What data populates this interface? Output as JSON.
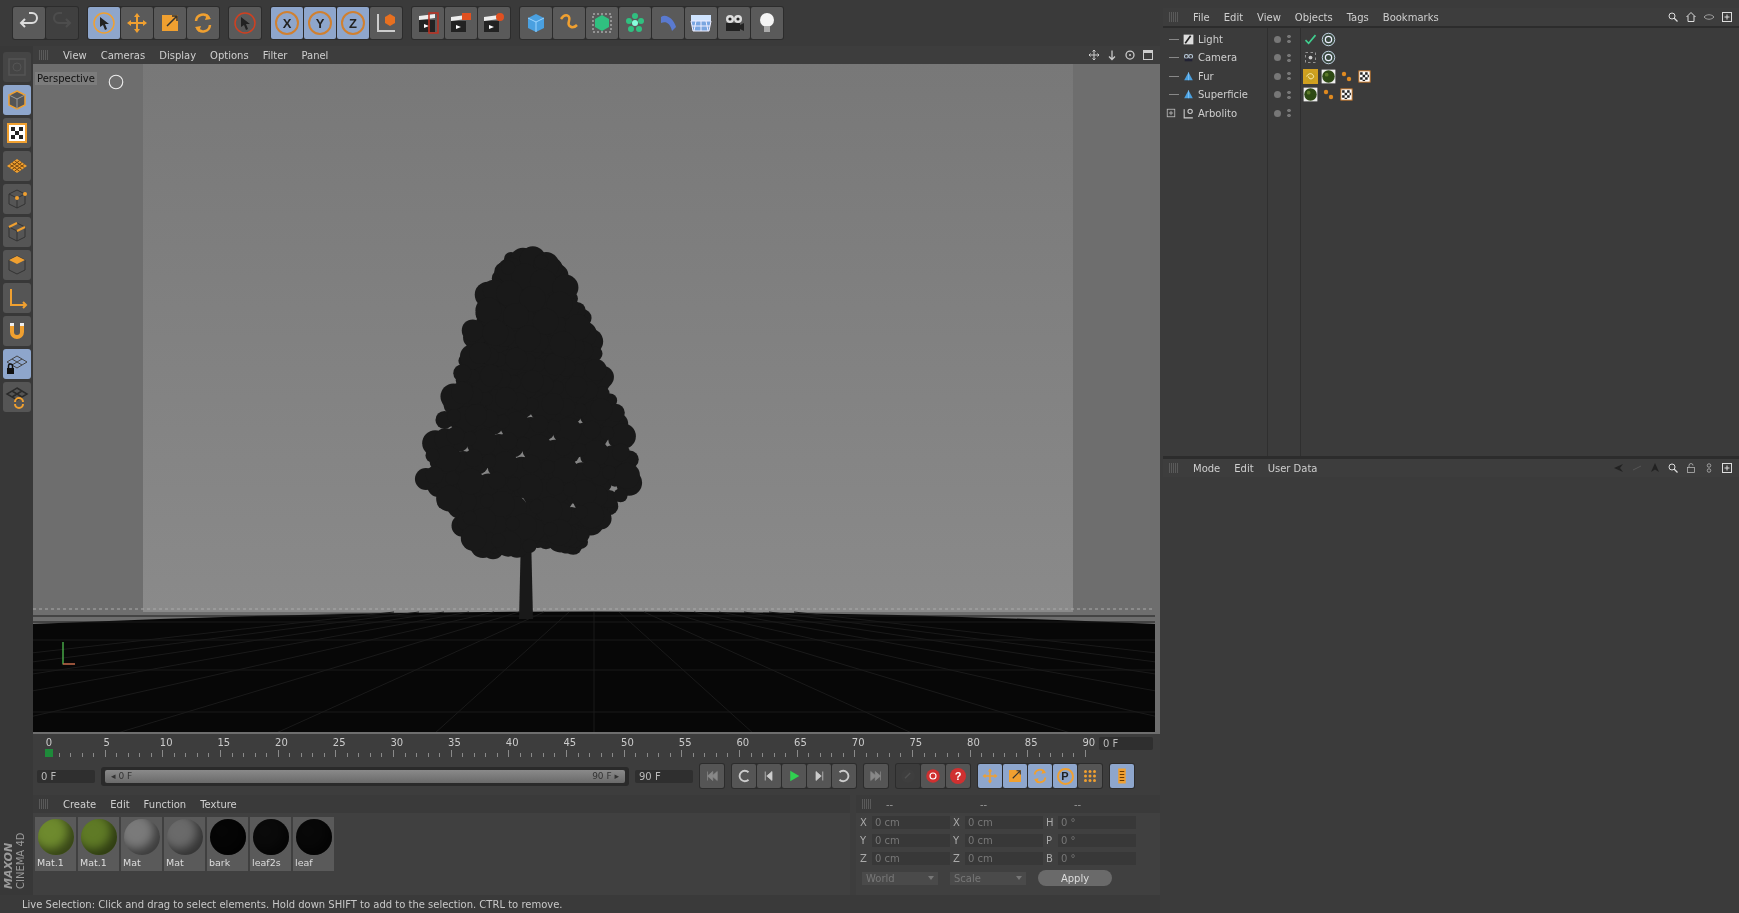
{
  "toolbar": [
    [
      {
        "kind": "undo",
        "selected": false,
        "disabled": false
      },
      {
        "kind": "redo",
        "selected": false,
        "disabled": true
      }
    ],
    [
      {
        "kind": "live-select",
        "selected": true,
        "disabled": false
      },
      {
        "kind": "move",
        "selected": false,
        "disabled": false
      },
      {
        "kind": "scale",
        "selected": false,
        "disabled": false
      },
      {
        "kind": "rotate",
        "selected": false,
        "disabled": false
      }
    ],
    [
      {
        "kind": "recent",
        "selected": false,
        "disabled": false
      }
    ],
    [
      {
        "kind": "axis",
        "label": "X",
        "selected": true,
        "disabled": false
      },
      {
        "kind": "axis",
        "label": "Y",
        "selected": true,
        "disabled": false
      },
      {
        "kind": "axis",
        "label": "Z",
        "selected": true,
        "disabled": false
      },
      {
        "kind": "coord",
        "selected": false,
        "disabled": false
      }
    ],
    [
      {
        "kind": "render-view",
        "selected": false,
        "disabled": false
      },
      {
        "kind": "render-picture",
        "selected": false,
        "disabled": false
      },
      {
        "kind": "render-settings",
        "selected": false,
        "disabled": false
      }
    ],
    [
      {
        "kind": "cube",
        "selected": false,
        "disabled": false
      },
      {
        "kind": "spline",
        "selected": false,
        "disabled": false
      },
      {
        "kind": "subdivision",
        "selected": false,
        "disabled": false
      },
      {
        "kind": "array",
        "selected": false,
        "disabled": false
      },
      {
        "kind": "deformer",
        "selected": false,
        "disabled": false
      },
      {
        "kind": "floor",
        "selected": false,
        "disabled": false
      },
      {
        "kind": "camera",
        "selected": false,
        "disabled": false
      },
      {
        "kind": "light",
        "selected": false,
        "disabled": false
      }
    ]
  ],
  "left_tools": [
    {
      "kind": "scene",
      "selected": false,
      "disabled": true
    },
    {
      "kind": "model",
      "selected": true,
      "disabled": false
    },
    {
      "kind": "texture",
      "selected": false,
      "disabled": false
    },
    {
      "kind": "workplane",
      "selected": false,
      "disabled": false
    },
    {
      "kind": "points",
      "selected": false,
      "disabled": false
    },
    {
      "kind": "edges",
      "selected": false,
      "disabled": false
    },
    {
      "kind": "polygons",
      "selected": false,
      "disabled": false
    },
    {
      "kind": "axes",
      "selected": false,
      "disabled": false
    },
    {
      "kind": "snap",
      "selected": false,
      "disabled": false
    },
    {
      "kind": "plane-lock",
      "selected": true,
      "disabled": false
    },
    {
      "kind": "plane-rotate",
      "selected": false,
      "disabled": false
    }
  ],
  "logo": {
    "brand": "MAXON",
    "product": "CINEMA 4D"
  },
  "viewport": {
    "menu": [
      "View",
      "Cameras",
      "Display",
      "Options",
      "Filter",
      "Panel"
    ],
    "camera": "Perspective"
  },
  "timeline": {
    "ticks": [
      "0",
      "5",
      "10",
      "15",
      "20",
      "25",
      "30",
      "35",
      "40",
      "45",
      "50",
      "55",
      "60",
      "65",
      "70",
      "75",
      "80",
      "85",
      "90"
    ],
    "level": 0,
    "current_frame": "0 F"
  },
  "transport": {
    "start": "0 F",
    "range": {
      "min": "◂ 0 F",
      "max": "90 F ▸",
      "level": 1
    },
    "end": "90 F",
    "buttons": [
      [
        {
          "kind": "first",
          "selected": false,
          "disabled": false
        }
      ],
      [
        {
          "kind": "loop-back",
          "selected": false,
          "disabled": false
        },
        {
          "kind": "prev",
          "selected": false,
          "disabled": false
        },
        {
          "kind": "play",
          "selected": false,
          "disabled": false
        },
        {
          "kind": "next",
          "selected": false,
          "disabled": false
        },
        {
          "kind": "loop",
          "selected": false,
          "disabled": false
        }
      ],
      [
        {
          "kind": "last",
          "selected": false,
          "disabled": false
        }
      ],
      [
        {
          "kind": "link",
          "selected": false,
          "disabled": true
        },
        {
          "kind": "record",
          "selected": false,
          "disabled": false
        },
        {
          "kind": "help",
          "label": "?",
          "selected": false,
          "disabled": false
        }
      ],
      [
        {
          "kind": "move",
          "selected": true,
          "disabled": false
        },
        {
          "kind": "scale",
          "selected": true,
          "disabled": false
        },
        {
          "kind": "rotate",
          "selected": true,
          "disabled": false
        },
        {
          "kind": "param",
          "label": "P",
          "selected": true,
          "disabled": false
        },
        {
          "kind": "grid-points",
          "selected": false,
          "disabled": false
        }
      ],
      [
        {
          "kind": "timeline",
          "selected": true,
          "disabled": false
        }
      ]
    ]
  },
  "materials": {
    "menu": [
      "Create",
      "Edit",
      "Function",
      "Texture"
    ],
    "items": [
      {
        "name": "Mat.1",
        "color": "#6e8a2e"
      },
      {
        "name": "Mat.1",
        "color": "#5f7a26"
      },
      {
        "name": "Mat",
        "color": "#7a7a7a"
      },
      {
        "name": "Mat",
        "color": "#6a6a6a"
      },
      {
        "name": "bark",
        "color": "#050505"
      },
      {
        "name": "leaf2s",
        "color": "#0a0a0a"
      },
      {
        "name": "leaf",
        "color": "#080808"
      }
    ]
  },
  "coordinates": {
    "headers": [
      "--",
      "--",
      "--"
    ],
    "rows": [
      {
        "axis": "X",
        "position": "0 cm",
        "size_axis": "X",
        "size": "0 cm",
        "rot_axis": "H",
        "rotation": "0 °"
      },
      {
        "axis": "Y",
        "position": "0 cm",
        "size_axis": "Y",
        "size": "0 cm",
        "rot_axis": "P",
        "rotation": "0 °"
      },
      {
        "axis": "Z",
        "position": "0 cm",
        "size_axis": "Z",
        "size": "0 cm",
        "rot_axis": "B",
        "rotation": "0 °"
      }
    ],
    "dropdowns": [
      "World",
      "Scale"
    ],
    "apply": "Apply"
  },
  "status_bar": "Live Selection: Click and drag to select elements. Hold down SHIFT to add to the selection. CTRL to remove.",
  "objects": {
    "menu": [
      "File",
      "Edit",
      "View",
      "Objects",
      "Tags",
      "Bookmarks"
    ],
    "rows": [
      {
        "name": "Light",
        "kind": "light",
        "expandable": false,
        "tags": [
          {
            "kind": "check",
            "selected": false
          },
          {
            "kind": "target",
            "selected": false
          }
        ]
      },
      {
        "name": "Camera",
        "kind": "camera",
        "expandable": false,
        "tags": [
          {
            "kind": "protection",
            "selected": false
          },
          {
            "kind": "target",
            "selected": false
          }
        ]
      },
      {
        "name": "Fur",
        "kind": "polygon",
        "expandable": false,
        "tags": [
          {
            "kind": "fur",
            "selected": true
          },
          {
            "kind": "material",
            "selected": false
          },
          {
            "kind": "uvw",
            "selected": false
          },
          {
            "kind": "checker",
            "selected": false
          }
        ]
      },
      {
        "name": "Superficie",
        "kind": "polygon",
        "expandable": false,
        "tags": [
          {
            "kind": "material",
            "selected": false
          },
          {
            "kind": "uvw",
            "selected": false
          },
          {
            "kind": "checker",
            "selected": false
          }
        ]
      },
      {
        "name": "Arbolito",
        "kind": "null",
        "expandable": true,
        "tags": []
      }
    ]
  },
  "attributes": {
    "menu": [
      "Mode",
      "Edit",
      "User Data"
    ]
  }
}
